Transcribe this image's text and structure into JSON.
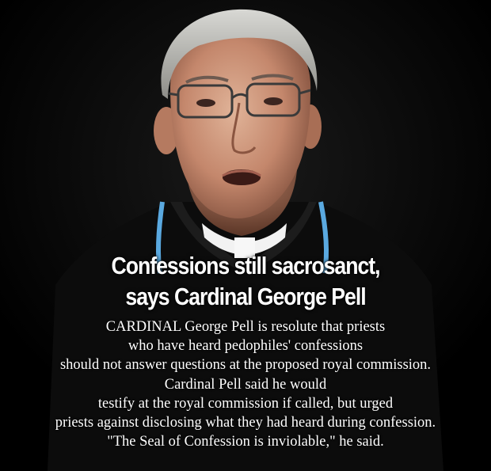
{
  "headline": {
    "line1": "Confessions still sacrosanct,",
    "line2": "says Cardinal George Pell"
  },
  "body": {
    "lines": [
      "CARDINAL George Pell is resolute that priests",
      "who have heard pedophiles' confessions",
      "should not answer questions at the proposed royal commission.",
      "Cardinal Pell said he would",
      "testify at the royal commission if called, but urged",
      "priests against disclosing what they had heard during confession.",
      "\"The Seal of Confession is inviolable,\" he said."
    ]
  },
  "colors": {
    "background": "#000000",
    "text": "#ffffff",
    "lanyard": "#5aa9e0"
  }
}
